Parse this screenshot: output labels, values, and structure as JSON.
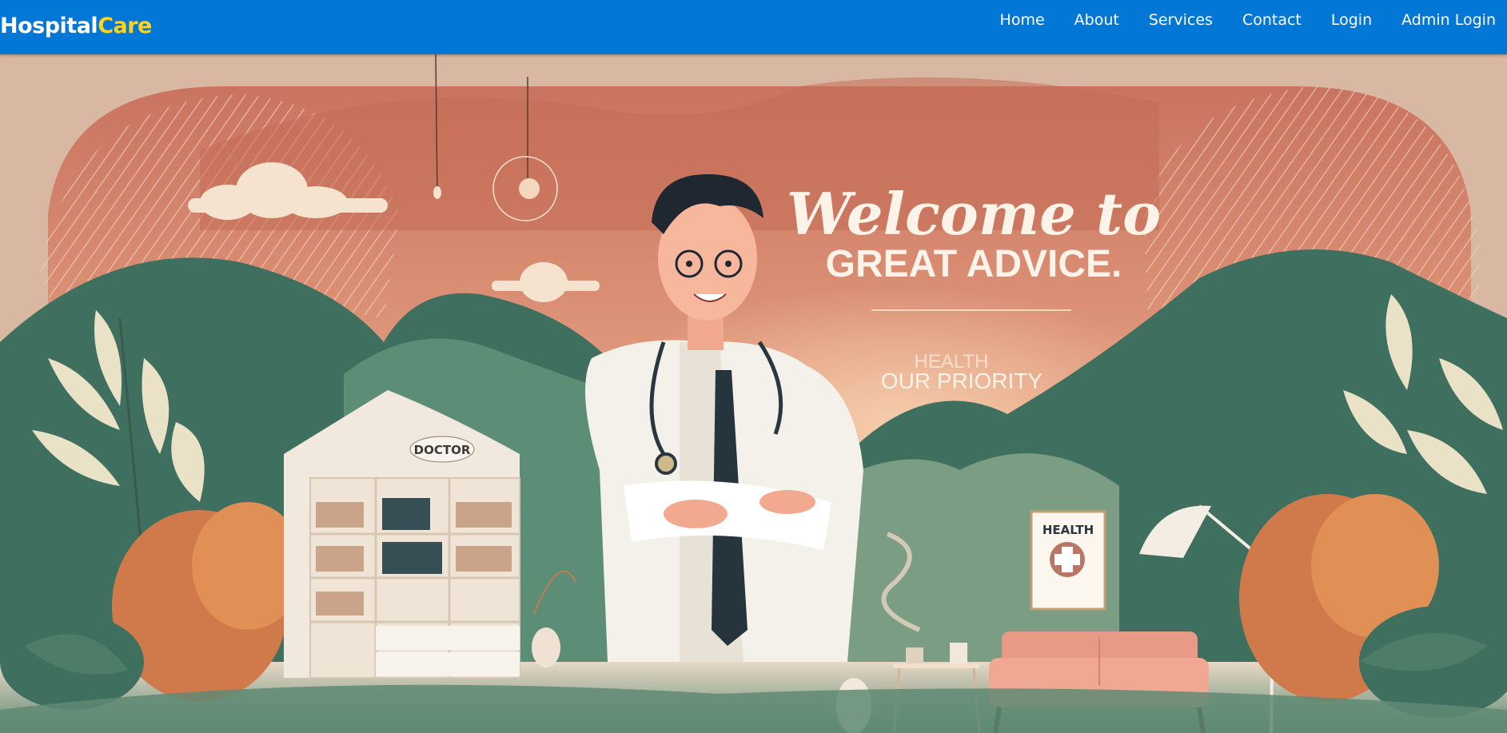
{
  "brand": {
    "part1": "Hospital",
    "part2": "Care"
  },
  "nav": {
    "items": [
      {
        "label": "Home"
      },
      {
        "label": "About"
      },
      {
        "label": "Services"
      },
      {
        "label": "Contact"
      },
      {
        "label": "Login"
      },
      {
        "label": "Admin Login"
      }
    ]
  },
  "hero": {
    "headline_script": "Welcome to",
    "headline_caps": "GREAT ADVICE.",
    "tagline_line1": "HEALTH",
    "tagline_line2": "OUR PRIORITY",
    "cabinet_sign": "DOCTOR",
    "poster_sign": "HEALTH"
  },
  "colors": {
    "navbar": "#0377d6",
    "brand_accent": "#ffd21f",
    "sky_top": "#c9745f",
    "sky_bottom": "#f3c7a4",
    "hills": "#3f6f5e",
    "sofa": "#e89a86"
  }
}
